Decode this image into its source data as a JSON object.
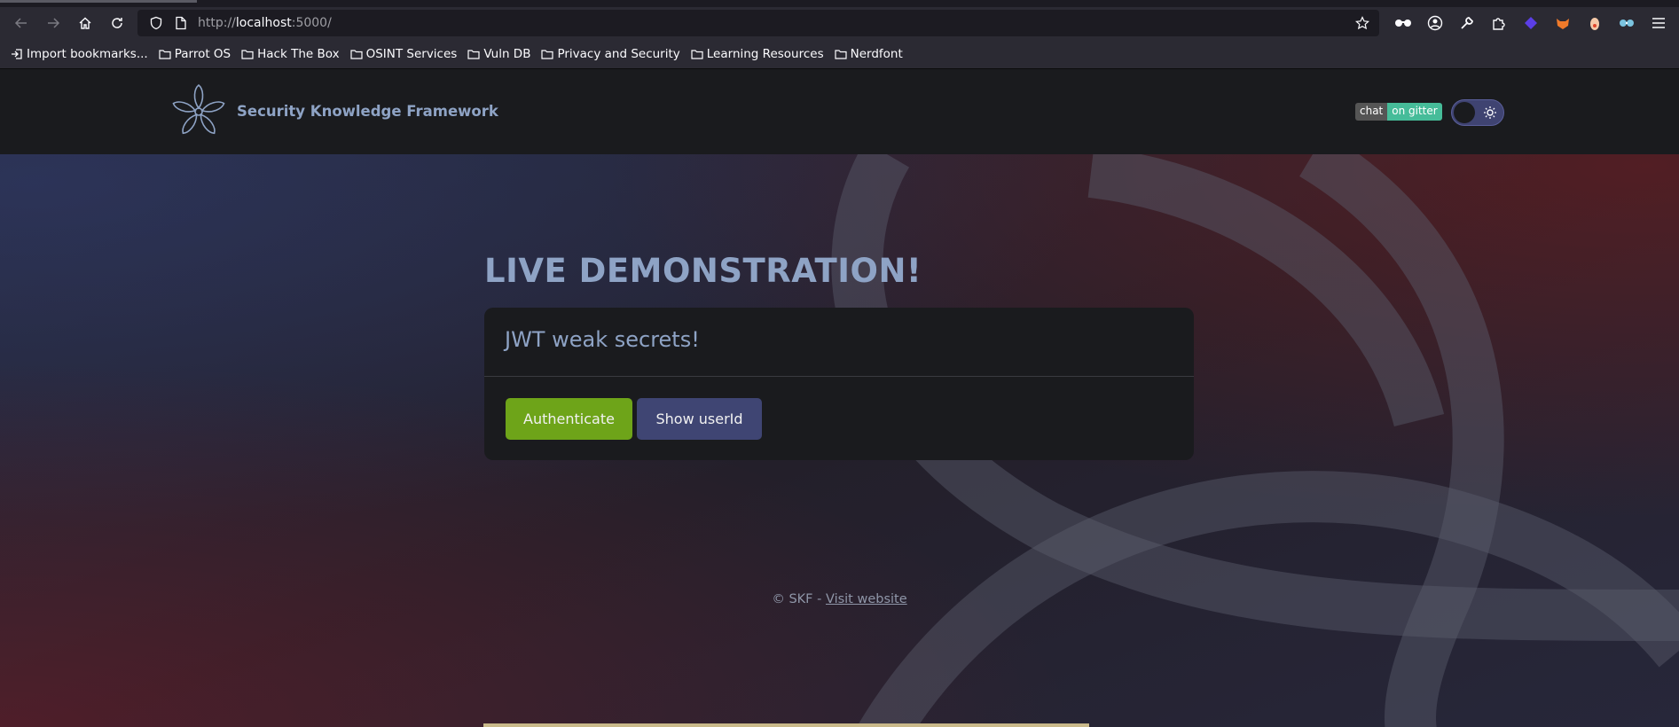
{
  "browser": {
    "url_scheme": "http://",
    "url_host": "localhost",
    "url_port": ":5000/",
    "bookmarks": [
      {
        "label": "Import bookmarks...",
        "icon": "import-icon"
      },
      {
        "label": "Parrot OS",
        "icon": "folder-icon"
      },
      {
        "label": "Hack The Box",
        "icon": "folder-icon"
      },
      {
        "label": "OSINT Services",
        "icon": "folder-icon"
      },
      {
        "label": "Vuln DB",
        "icon": "folder-icon"
      },
      {
        "label": "Privacy and Security",
        "icon": "folder-icon"
      },
      {
        "label": "Learning Resources",
        "icon": "folder-icon"
      },
      {
        "label": "Nerdfont",
        "icon": "folder-icon"
      }
    ]
  },
  "app": {
    "brand": "Security Knowledge Framework",
    "badge_left": "chat",
    "badge_right": "on gitter"
  },
  "main": {
    "headline": "LIVE DEMONSTRATION!",
    "card_title": "JWT weak secrets!",
    "authenticate_label": "Authenticate",
    "show_userid_label": "Show userId"
  },
  "footer": {
    "copyright": "© SKF - ",
    "link_label": "Visit website"
  },
  "colors": {
    "accent_green": "#6ea419",
    "accent_indigo": "#3f4573",
    "brand_blue": "#8ea3c5"
  }
}
